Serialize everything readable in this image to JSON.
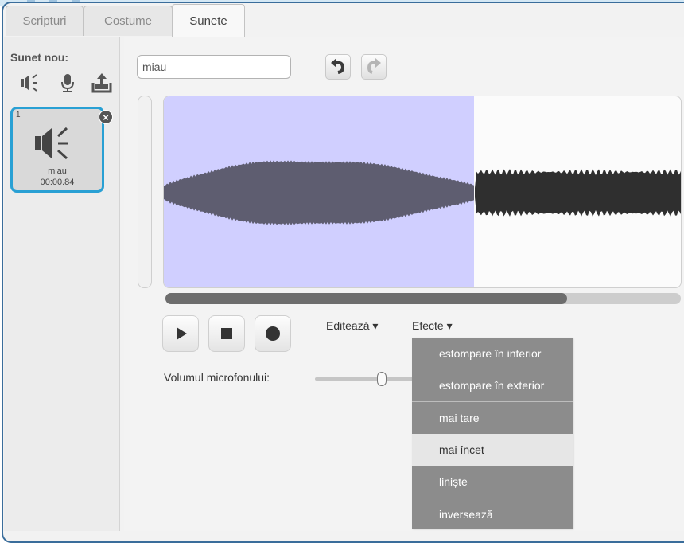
{
  "tabs": [
    {
      "label": "Scripturi",
      "active": false
    },
    {
      "label": "Costume",
      "active": false
    },
    {
      "label": "Sunete",
      "active": true
    }
  ],
  "sidebar": {
    "new_sound_label": "Sunet nou:",
    "tools": [
      "speaker-library-icon",
      "microphone-icon",
      "upload-icon"
    ],
    "sounds": [
      {
        "number": "1",
        "name": "miau",
        "duration": "00:00.84",
        "selected": true
      }
    ]
  },
  "editor": {
    "sound_name": "miau",
    "undo_icon": "undo-icon",
    "redo_icon": "redo-icon",
    "selection_fraction": 0.6,
    "scroll_fraction": 0.78,
    "controls": [
      "play-icon",
      "stop-icon",
      "record-icon"
    ],
    "edit_menu": "Editează ▾",
    "effects_menu": "Efecte ▾",
    "mic_volume_label": "Volumul microfonului:",
    "mic_volume_fraction": 0.7
  },
  "effects_dropdown": {
    "items": [
      {
        "label": "estompare în interior",
        "hover": false
      },
      {
        "label": "estompare în exterior",
        "hover": false
      },
      {
        "label": "mai tare",
        "hover": false
      },
      {
        "label": "mai încet",
        "hover": true
      },
      {
        "label": "liniște",
        "hover": false
      },
      {
        "label": "inversează",
        "hover": false
      }
    ]
  },
  "colors": {
    "selection": "#d0cfff",
    "wave_selected": "#5e5d70",
    "wave_unselected": "#2f2f2f",
    "frame": "#3a6d9b",
    "card_border": "#29a0d4"
  }
}
